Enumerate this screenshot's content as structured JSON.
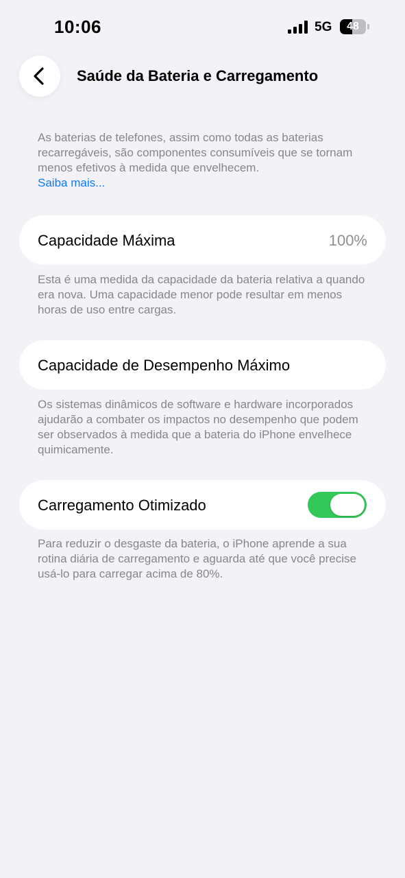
{
  "status_bar": {
    "time": "10:06",
    "network": "5G",
    "battery_level": "48",
    "battery_fraction": 0.48
  },
  "header": {
    "title": "Saúde da Bateria e Carregamento",
    "back_icon": "chevron-left-icon"
  },
  "intro": {
    "text": "As baterias de telefones, assim como todas as baterias recarregáveis, são componentes consumíveis que se tornam menos efetivos à medida que envelhecem.",
    "link": "Saiba mais..."
  },
  "max_capacity": {
    "label": "Capacidade Máxima",
    "value": "100%",
    "note": "Esta é uma medida da capacidade da bateria relativa a quando era nova. Uma capacidade menor pode resultar em menos horas de uso entre cargas."
  },
  "peak_performance": {
    "label": "Capacidade de Desempenho Máximo",
    "note": "Os sistemas dinâmicos de software e hardware incorporados ajudarão a combater os impactos no desempenho que podem ser observados à medida que a bateria do iPhone envelhece quimicamente."
  },
  "optimized_charging": {
    "label": "Carregamento Otimizado",
    "enabled": true,
    "note": "Para reduzir o desgaste da bateria, o iPhone aprende a sua rotina diária de carregamento e aguarda até que você precise usá-lo para carregar acima de 80%."
  },
  "colors": {
    "background": "#f2f2f7",
    "accent_link": "#0a7aff",
    "toggle_on": "#34c759",
    "secondary_text": "#86868b"
  }
}
